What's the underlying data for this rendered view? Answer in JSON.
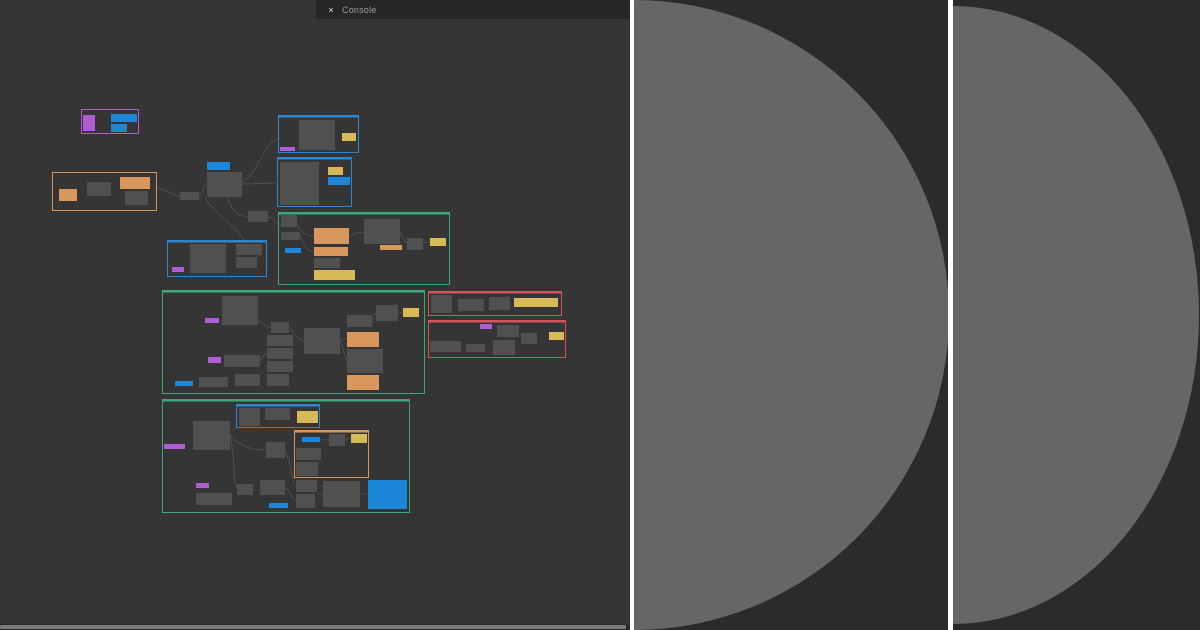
{
  "console": {
    "title": "Console",
    "close_glyph": "×"
  },
  "canvas": {
    "background": "#353535",
    "wire_color": "#5a5a5a",
    "node_fill": "#505050",
    "frame_colors": {
      "purple": "#b25bd0",
      "orange": "#d8955b",
      "blue": "#2e86d0",
      "green": "#3aa97a",
      "red": "#d2555a"
    },
    "port_colors": {
      "blue": "#1c86d8",
      "purple": "#b05dd4",
      "yellow": "#d7b957",
      "orange": "#d7975d"
    }
  },
  "side_panels": [
    {
      "background": "#2b2b2b",
      "disc_color": "#666666"
    },
    {
      "background": "#2b2b2b",
      "disc_color": "#666666"
    }
  ]
}
